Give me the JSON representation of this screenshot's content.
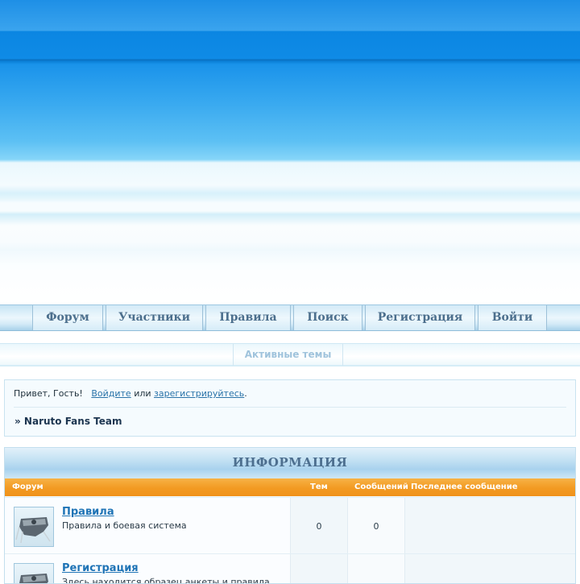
{
  "nav": {
    "items": [
      {
        "label": "Форум"
      },
      {
        "label": "Участники"
      },
      {
        "label": "Правила"
      },
      {
        "label": "Поиск"
      },
      {
        "label": "Регистрация"
      },
      {
        "label": "Войти"
      }
    ]
  },
  "subnav": {
    "active_topics": "Активные темы"
  },
  "welcome": {
    "greeting": "Привет, Гость!",
    "login_link": "Войдите",
    "or_text": "или",
    "register_link": "зарегистрируйтесь",
    "end_dot": ".",
    "breadcrumb": "» Naruto Fans Team"
  },
  "forum": {
    "category_title": "ИНФОРМАЦИЯ",
    "columns": {
      "forum": "Форум",
      "topics": "Тем",
      "messages": "Сообщений",
      "last_post": "Последнее сообщение"
    },
    "rows": [
      {
        "title": "Правила",
        "description": "Правила и боевая система",
        "topics": "0",
        "messages": "0",
        "last_post": ""
      },
      {
        "title": "Регистрация",
        "description": "Здесь находится образец анкеты и правила",
        "topics": "",
        "messages": "",
        "last_post": ""
      }
    ]
  },
  "colors": {
    "banner_blue": "#0f8be6",
    "nav_text": "#4c6f8d",
    "column_header_orange": "#f29a22",
    "link_blue": "#1f74b6"
  },
  "icons": {
    "forum_icon": "ninja-headband-icon"
  }
}
